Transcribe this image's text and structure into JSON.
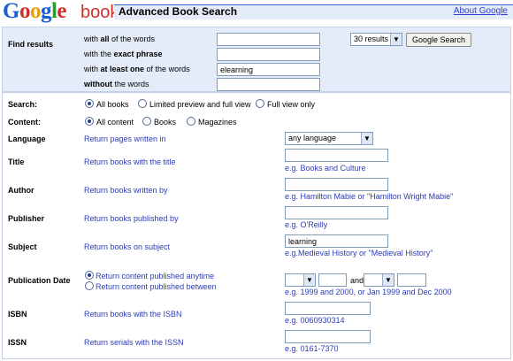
{
  "header": {
    "logo_google": [
      "G",
      "o",
      "o",
      "g",
      "l",
      "e"
    ],
    "logo_books": "books",
    "title": "Advanced Book Search",
    "about": "About Google"
  },
  "find": {
    "label": "Find results",
    "rows": [
      {
        "pre": "with ",
        "bold": "all",
        "post": " of the words",
        "value": ""
      },
      {
        "pre": "with the ",
        "bold": "exact phrase",
        "post": "",
        "value": ""
      },
      {
        "pre": "with ",
        "bold": "at least one",
        "post": " of the words",
        "value": "elearning"
      },
      {
        "pre": "",
        "bold": "without",
        "post": " the words",
        "value": ""
      }
    ],
    "results_select": "30 results",
    "search_button": "Google Search"
  },
  "search": {
    "label": "Search:",
    "options": [
      "All books",
      "Limited preview and full view",
      "Full view only"
    ],
    "selected": "All books"
  },
  "content": {
    "label": "Content:",
    "options": [
      "All content",
      "Books",
      "Magazines"
    ],
    "selected": "All content"
  },
  "language": {
    "label": "Language",
    "desc": "Return pages written in",
    "select": "any language"
  },
  "title": {
    "label": "Title",
    "desc": "Return books with the title",
    "value": "",
    "hint": "e.g. Books and Culture"
  },
  "author": {
    "label": "Author",
    "desc": "Return books written by",
    "value": "",
    "hint": "e.g. Hamilton Mabie or \"Hamilton Wright Mabie\""
  },
  "publisher": {
    "label": "Publisher",
    "desc": "Return books published by",
    "value": "",
    "hint": "e.g. O'Reilly"
  },
  "subject": {
    "label": "Subject",
    "desc": "Return books on subject",
    "value": "learning",
    "hint": "e.g.Medieval History or \"Medieval History\""
  },
  "pubdate": {
    "label": "Publication Date",
    "opt1": "Return content published anytime",
    "opt2": "Return content published between",
    "and": "and",
    "hint": "e.g. 1999 and 2000, or Jan 1999 and Dec 2000"
  },
  "isbn": {
    "label": "ISBN",
    "desc": "Return books with the ISBN",
    "value": "",
    "hint": "e.g. 0060930314"
  },
  "issn": {
    "label": "ISSN",
    "desc": "Return serials with the ISSN",
    "value": "",
    "hint": "e.g. 0161-7370"
  }
}
